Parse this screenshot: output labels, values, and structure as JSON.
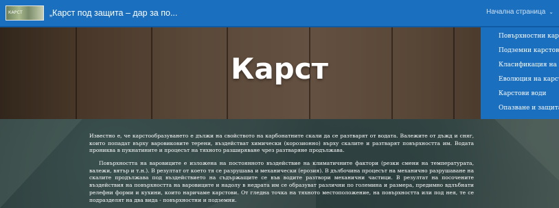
{
  "header": {
    "logo_text": "КАРСТ",
    "site_title": "„Карст под защита – дар за по...",
    "nav_current": "Начална страница"
  },
  "icons": {
    "dropdown": "chevron-down-icon"
  },
  "colors": {
    "topbar": "#1a6fbf",
    "dropdown_bg": "#1a6fbf"
  },
  "dropdown": {
    "items": [
      "Повърхностни карс...",
      "Подземни карстови ...",
      "Класификация на пе...",
      "Еволюция на карста",
      "Карстови води",
      "Опазване и защита ..."
    ]
  },
  "hero": {
    "title": "Карст"
  },
  "content": {
    "paragraph1": "Известно е, че карстообразуването е дължи на свойството на карбонатните скали да се разтварят от водата. Валежите от дъжд и сняг, които попадат върху варовиковите терени, въздействат химически (корозионно) върху скалите и разтварят повърхността им. Водата прониква в пукнатините и процесът на тяхното разширяване чрез разтваряне продължава.",
    "paragraph2": "Повърхността на варовиците е изложена на постоянното въздействие на климатичните фактори (резки смени на температурата, валежи, вятър и т.н.). В резултат от което тя се разрушава и механически (ерозия). В дълбочина процесът на механично разрушаване на скалите продължава под въздействието на съдържащите се във водите разтвори механични частици. В резултат на посочените въздействия на повърхността на варовиците и надолу в недрата им се образуват различни по големина и размера, предимно вдлъбнати релефни форми и кухини, които наричаме карстови. От гледна точка на тяхното местоположение, на повърхността или под нея, те се подразделят на два вида - повърхностни и подземни."
  }
}
